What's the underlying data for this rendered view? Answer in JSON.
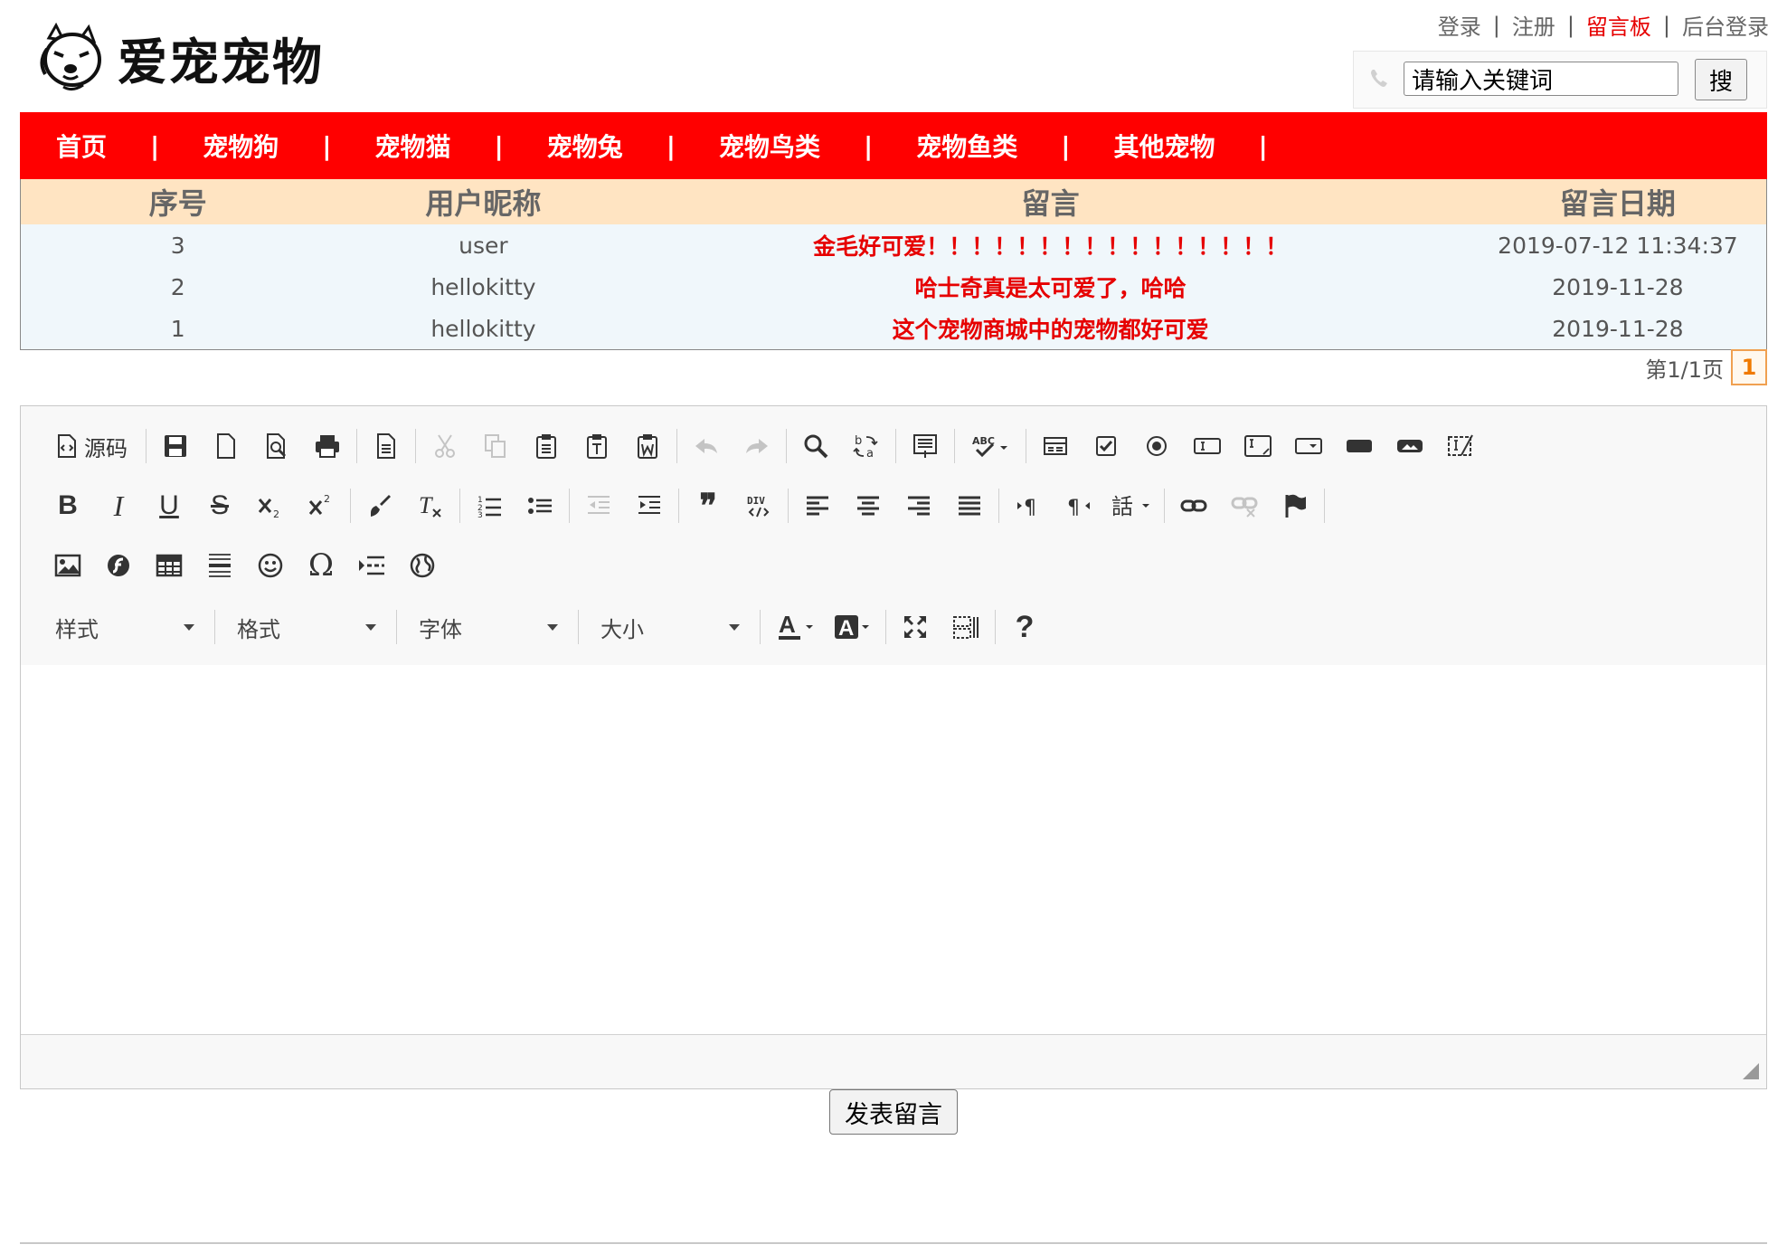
{
  "header": {
    "site_name": "爱宠宠物",
    "top_links": [
      {
        "label": "登录",
        "active": false
      },
      {
        "label": "注册",
        "active": false
      },
      {
        "label": "留言板",
        "active": true
      },
      {
        "label": "后台登录",
        "active": false
      }
    ],
    "top_link_sep": "|",
    "search": {
      "value": "请输入关键词",
      "button_label": "搜"
    }
  },
  "nav": {
    "items": [
      "首页",
      "宠物狗",
      "宠物猫",
      "宠物兔",
      "宠物鸟类",
      "宠物鱼类",
      "其他宠物"
    ],
    "separator": "|"
  },
  "messages": {
    "headers": [
      "序号",
      "用户昵称",
      "留言",
      "留言日期"
    ],
    "rows": [
      {
        "id": "3",
        "user": "user",
        "message": "金毛好可爱！！！！！！！！！！！！！！！！",
        "date": "2019-07-12 11:34:37"
      },
      {
        "id": "2",
        "user": "hellokitty",
        "message": "哈士奇真是太可爱了，哈哈",
        "date": "2019-11-28"
      },
      {
        "id": "1",
        "user": "hellokitty",
        "message": "这个宠物商城中的宠物都好可爱",
        "date": "2019-11-28"
      }
    ]
  },
  "pagination": {
    "info": "第1/1页",
    "current": "1"
  },
  "editor": {
    "source_label": "源码",
    "combos": [
      "样式",
      "格式",
      "字体",
      "大小"
    ]
  },
  "submit_label": "发表留言",
  "colors": {
    "nav_bg": "#ff0000",
    "header_row_bg": "#ffe4c2",
    "row_bg": "#f0f7fb",
    "message_text": "#e60000",
    "active_link": "#e60000"
  }
}
